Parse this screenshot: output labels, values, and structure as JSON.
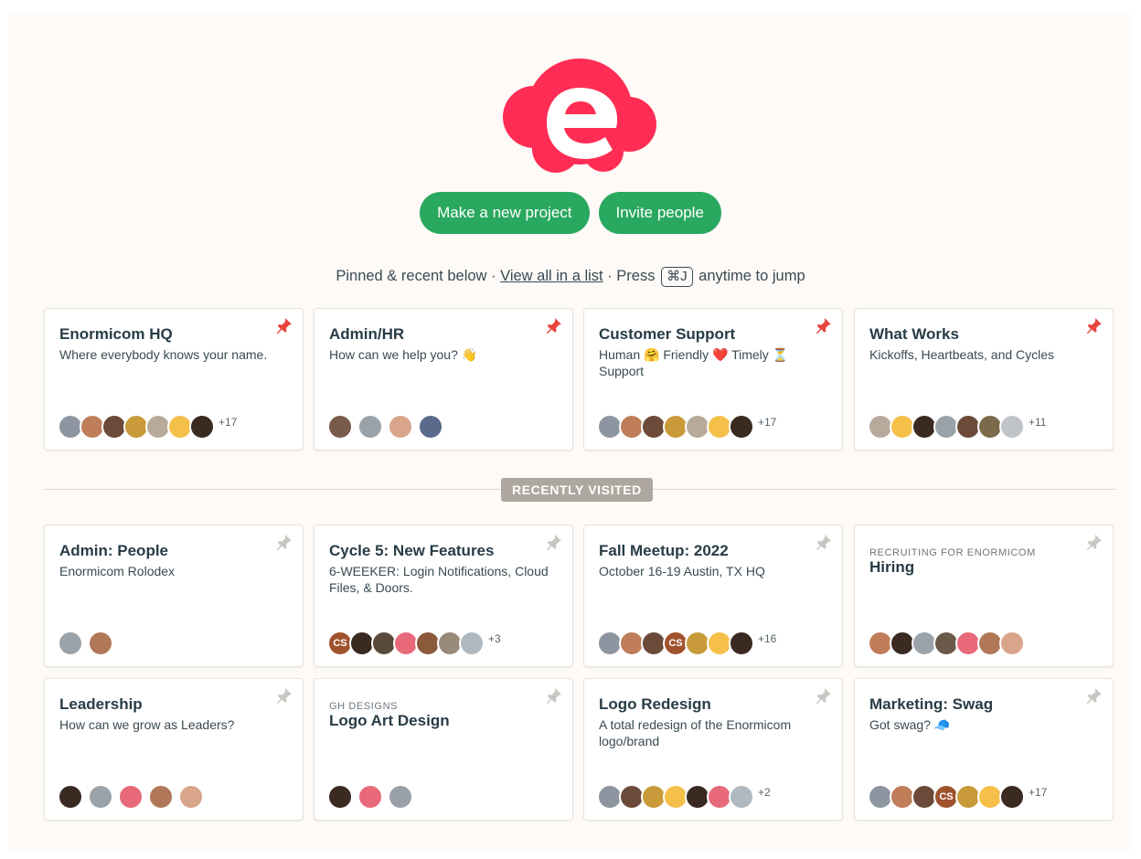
{
  "actions": {
    "new_project": "Make a new project",
    "invite": "Invite people"
  },
  "hint": {
    "prefix": "Pinned & recent below ·",
    "link": "View all in a list",
    "middle": "· Press",
    "shortcut": "⌘J",
    "suffix": "anytime to jump"
  },
  "divider_label": "RECENTLY VISITED",
  "colors": {
    "brand": "#ff2d55",
    "button": "#29a85f",
    "pin_active": "#e8453c",
    "pin_inactive": "#c9c6c2"
  },
  "pinned": [
    {
      "title": "Enormicom HQ",
      "desc": "Where everybody knows your name.",
      "more": "+17",
      "avatars": [
        "#8d96a0",
        "#c07d5a",
        "#6b4a3a",
        "#c89a3a",
        "#b8aa9a",
        "#f5c04a",
        "#3a2a22"
      ]
    },
    {
      "title": "Admin/HR",
      "desc": "How can we help you? 👋",
      "more": "",
      "avatars": [
        "#7a5a4a",
        "#9ba3aa",
        "#d9a58a",
        "#5a6a8a"
      ]
    },
    {
      "title": "Customer Support",
      "desc": "Human 🤗 Friendly ❤️ Timely ⏳ Support",
      "more": "+17",
      "avatars": [
        "#8d96a0",
        "#c07d5a",
        "#6b4a3a",
        "#c89a3a",
        "#b8aa9a",
        "#f5c04a",
        "#3a2a22"
      ]
    },
    {
      "title": "What Works",
      "desc": "Kickoffs, Heartbeats, and Cycles",
      "more": "+11",
      "avatars": [
        "#b8aa9a",
        "#f5c04a",
        "#3a2a22",
        "#9ba3aa",
        "#6b4a3a",
        "#7a6a4a",
        "#c0c4c8"
      ]
    }
  ],
  "recent": [
    {
      "eyebrow": "",
      "title": "Admin: People",
      "desc": "Enormicom Rolodex",
      "more": "",
      "avatars": [
        "#9ba3aa",
        "#b07858"
      ]
    },
    {
      "eyebrow": "",
      "title": "Cycle 5: New Features",
      "desc": "6-WEEKER: Login Notifications, Cloud Files, & Doors.",
      "more": "+3",
      "avatars": [
        "#a0522d",
        "#3a2a22",
        "#5a4a3a",
        "#e86a7a",
        "#8b5a3a",
        "#9a8a7a",
        "#b0b8c0"
      ],
      "initials": "CS"
    },
    {
      "eyebrow": "",
      "title": "Fall Meetup: 2022",
      "desc": "October 16-19 Austin, TX HQ",
      "more": "+16",
      "avatars": [
        "#8d96a0",
        "#c07d5a",
        "#6b4a3a",
        "#a0522d",
        "#c89a3a",
        "#f5c04a",
        "#3a2a22"
      ],
      "initials": "CS"
    },
    {
      "eyebrow": "RECRUITING FOR ENORMICOM",
      "title": "Hiring",
      "desc": "",
      "more": "",
      "avatars": [
        "#c07d5a",
        "#3a2a22",
        "#9ba3aa",
        "#6b5a4a",
        "#e86a7a",
        "#b07858",
        "#d9a58a"
      ]
    },
    {
      "eyebrow": "",
      "title": "Leadership",
      "desc": "How can we grow as Leaders?",
      "more": "",
      "avatars": [
        "#3a2a22",
        "#9ba3aa",
        "#e86a7a",
        "#b07858",
        "#d9a58a"
      ]
    },
    {
      "eyebrow": "GH DESIGNS",
      "title": "Logo Art Design",
      "desc": "",
      "more": "",
      "avatars": [
        "#3a2a22",
        "#e86a7a",
        "#9aa0a8"
      ]
    },
    {
      "eyebrow": "",
      "title": "Logo Redesign",
      "desc": "A total redesign of the Enormicom logo/brand",
      "more": "+2",
      "avatars": [
        "#8d96a0",
        "#6b4a3a",
        "#c89a3a",
        "#f5c04a",
        "#3a2a22",
        "#e86a7a",
        "#b0b8c0"
      ]
    },
    {
      "eyebrow": "",
      "title": "Marketing: Swag",
      "desc": "Got swag? 🧢",
      "more": "+17",
      "avatars": [
        "#8d96a0",
        "#c07d5a",
        "#6b4a3a",
        "#a0522d",
        "#c89a3a",
        "#f5c04a",
        "#3a2a22"
      ],
      "initials": "CS"
    }
  ]
}
